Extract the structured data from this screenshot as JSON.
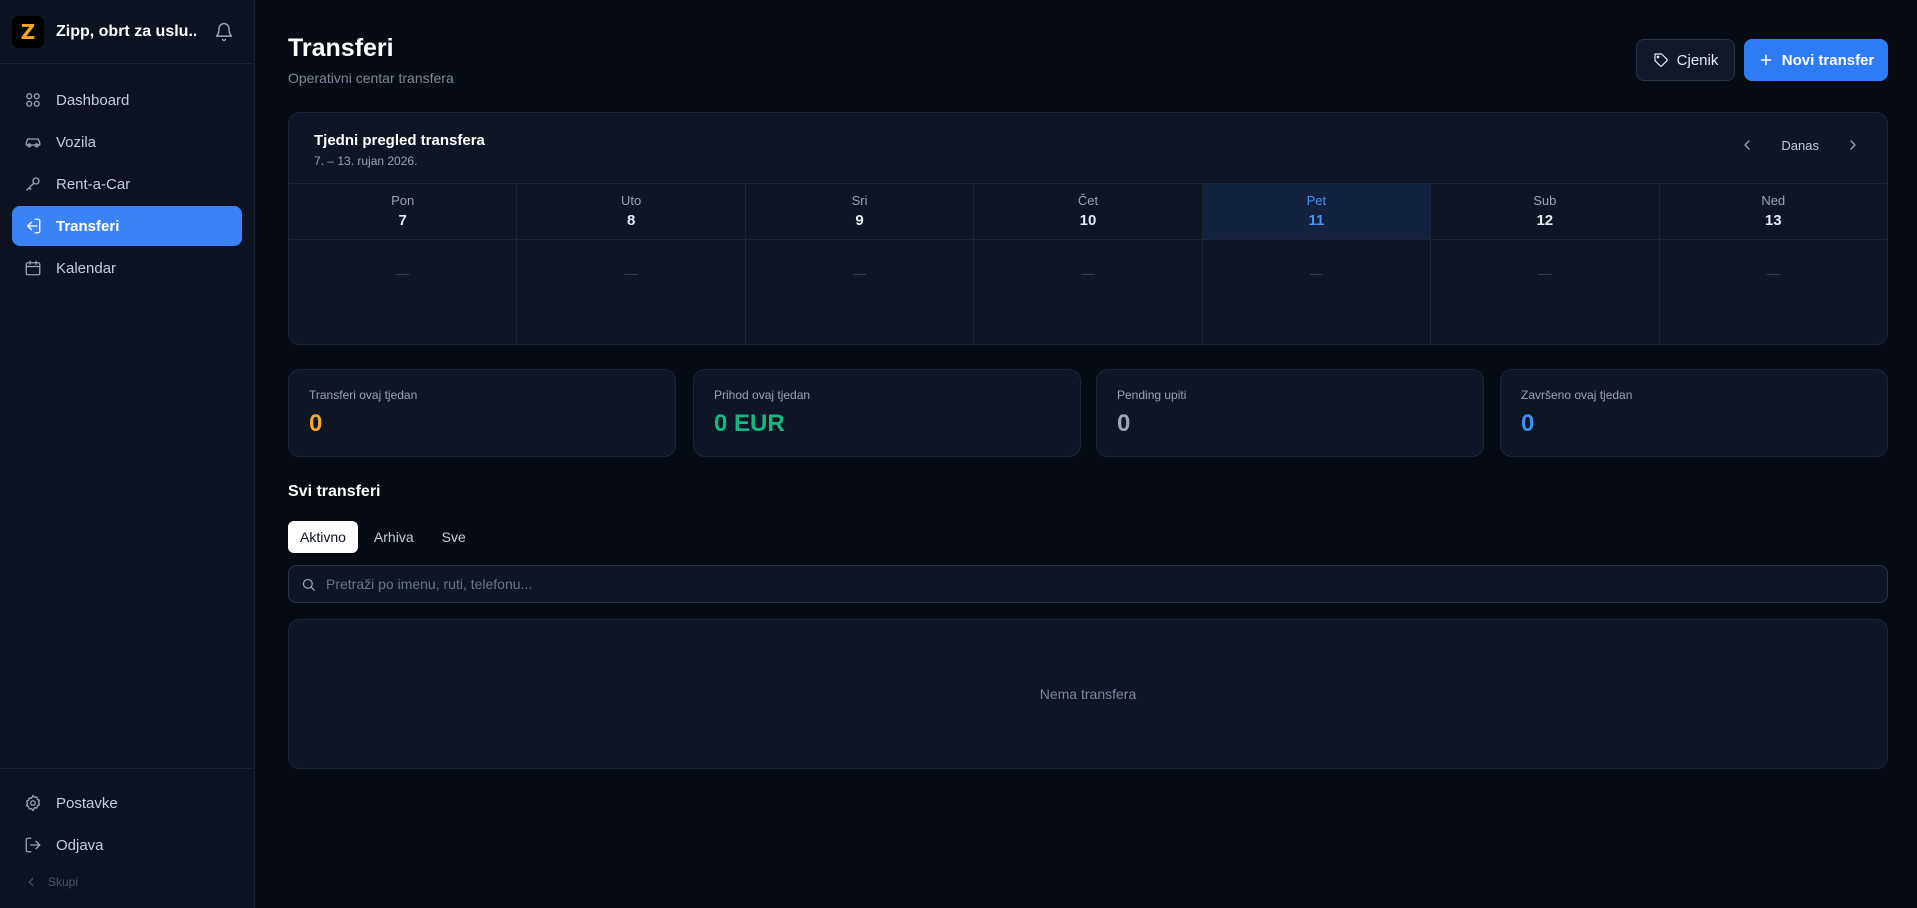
{
  "brand": {
    "logo_letter": "Z",
    "name": "Zipp, obrt za uslu..."
  },
  "sidebar": {
    "items": [
      {
        "label": "Dashboard",
        "icon": "grid-icon"
      },
      {
        "label": "Vozila",
        "icon": "car-icon"
      },
      {
        "label": "Rent-a-Car",
        "icon": "key-icon"
      },
      {
        "label": "Transferi",
        "icon": "login-icon",
        "active": true
      },
      {
        "label": "Kalendar",
        "icon": "calendar-icon"
      }
    ],
    "bottom": [
      {
        "label": "Postavke",
        "icon": "gear-icon"
      },
      {
        "label": "Odjava",
        "icon": "logout-icon"
      }
    ],
    "collapse_label": "Skupi"
  },
  "header": {
    "title": "Transferi",
    "subtitle": "Operativni centar transfera",
    "pricing_label": "Cjenik",
    "new_label": "Novi transfer"
  },
  "week": {
    "title": "Tjedni pregled transfera",
    "range": "7. – 13. rujan 2026.",
    "today_label": "Danas",
    "days": [
      {
        "name": "Pon",
        "num": "7",
        "empty": "—"
      },
      {
        "name": "Uto",
        "num": "8",
        "empty": "—"
      },
      {
        "name": "Sri",
        "num": "9",
        "empty": "—"
      },
      {
        "name": "Čet",
        "num": "10",
        "empty": "—"
      },
      {
        "name": "Pet",
        "num": "11",
        "empty": "—",
        "today": true
      },
      {
        "name": "Sub",
        "num": "12",
        "empty": "—"
      },
      {
        "name": "Ned",
        "num": "13",
        "empty": "—"
      }
    ]
  },
  "stats": [
    {
      "label": "Transferi ovaj tjedan",
      "value": "0",
      "color": "#f5a623"
    },
    {
      "label": "Prihod ovaj tjedan",
      "value": "0 EUR",
      "color": "#10b981"
    },
    {
      "label": "Pending upiti",
      "value": "0",
      "color": "#9aa4b4"
    },
    {
      "label": "Završeno ovaj tjedan",
      "value": "0",
      "color": "#3b8ff6"
    }
  ],
  "list": {
    "title": "Svi transferi",
    "tabs": [
      {
        "label": "Aktivno",
        "active": true
      },
      {
        "label": "Arhiva"
      },
      {
        "label": "Sve"
      }
    ],
    "search_placeholder": "Pretraži po imenu, ruti, telefonu...",
    "empty_text": "Nema transfera"
  },
  "colors": {
    "accent": "#3b82f6",
    "background": "#070b14",
    "panel": "#0e1524"
  }
}
